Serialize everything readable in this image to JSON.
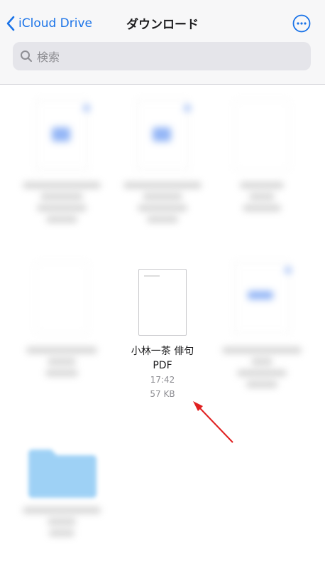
{
  "nav": {
    "back_label": "iCloud Drive",
    "title": "ダウンロード",
    "more_icon": "ellipsis-circle-icon"
  },
  "search": {
    "placeholder": "検索",
    "icon": "magnifier-icon"
  },
  "focused_file": {
    "name_line1": "小林一茶 俳句",
    "name_line2": "PDF",
    "time": "17:42",
    "size": "57 KB"
  },
  "annotation": {
    "arrow_color": "#e02020"
  },
  "colors": {
    "accent": "#1a73e8",
    "folder": "#5fb3f0"
  }
}
